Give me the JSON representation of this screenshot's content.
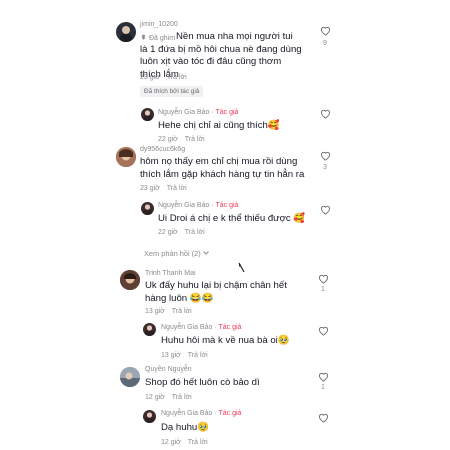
{
  "comments": [
    {
      "username": "jimin_10200",
      "pinned_label": "Đã ghim",
      "text": "Nền mua nha mọi người tui là 1 đứa bị mồ hôi chua nè đang dùng luôn xịt vào tóc đi đâu cũng thơm thích lắm",
      "time": "23 giờ",
      "reply_label": "Trả lời",
      "likes": "9",
      "liked_by_author": "Đã thích bởi tác giả",
      "avatar_color": "#2b2f3a"
    },
    {
      "username": "Nguyễn Gia Bảo",
      "author_tag": "Tác giả",
      "text": "Hehe chị chỉ ai cũng thích🥰",
      "time": "22 giờ",
      "reply_label": "Trả lời",
      "avatar_color": "#3b2b2f"
    },
    {
      "username": "dy956cuc6k6g",
      "text": "hôm nọ thấy em chỉ chị mua rồi dùng thích lắm gặp khách hàng tự tin hẳn ra",
      "time": "23 giờ",
      "reply_label": "Trả lời",
      "likes": "3",
      "avatar_color": "#8a5a44"
    },
    {
      "username": "Nguyễn Gia Bảo",
      "author_tag": "Tác giả",
      "text": "Ui Droi á chị e k thể thiếu được 🥰",
      "time": "22 giờ",
      "reply_label": "Trả lời",
      "avatar_color": "#3b2b2f"
    },
    {
      "more_replies": "Xem phản hồi (2)"
    },
    {
      "username": "Trinh Thanh Mai",
      "text": "Uk đấy huhu lại bị chậm chân hết hàng luôn 😂😂",
      "time": "13 giờ",
      "reply_label": "Trả lời",
      "likes": "1",
      "avatar_color": "#6b4b3e"
    },
    {
      "username": "Nguyễn Gia Bảo",
      "author_tag": "Tác giả",
      "text": "Huhu hôi mà k về nua bà oi🥹",
      "time": "13 giờ",
      "reply_label": "Trả lời",
      "avatar_color": "#3b2b2f"
    },
    {
      "username": "Quyền Nguyễn",
      "text": "Shop đó hết luôn cò bảo dì",
      "time": "12 giờ",
      "reply_label": "Trả lời",
      "likes": "1",
      "avatar_color": "#7a8899"
    },
    {
      "username": "Nguyễn Gia Bảo",
      "author_tag": "Tác giả",
      "text": "Dạ huhu🥹",
      "time": "12 giờ",
      "reply_label": "Trả lời",
      "avatar_color": "#3b2b2f"
    }
  ],
  "colors": {
    "author_accent": "#f23a5a",
    "meta_gray": "#8a8b91",
    "text": "#161823"
  },
  "icons": {
    "heart": "heart-outline-icon",
    "pin": "pin-icon",
    "chevron": "chevron-down-icon",
    "cursor": "mouse-cursor-icon"
  }
}
